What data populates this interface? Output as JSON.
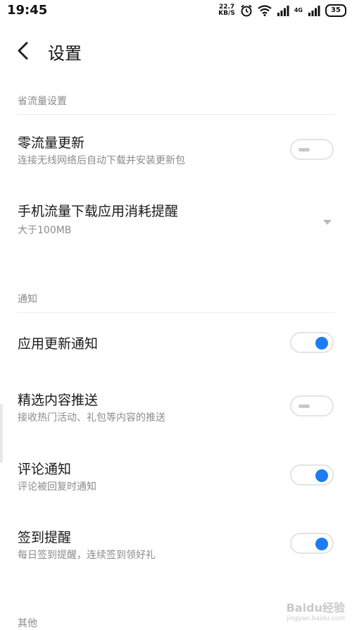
{
  "status_bar": {
    "time": "19:45",
    "net_speed_value": "22.7",
    "net_speed_unit": "KB/S",
    "network_type": "4G",
    "battery": "35"
  },
  "app_bar": {
    "title": "设置"
  },
  "sections": {
    "data_saving": {
      "header": "省流量设置",
      "zero_data_update": {
        "title": "零流量更新",
        "subtitle": "连接无线网络后自动下载并安装更新包",
        "enabled": false
      },
      "mobile_data_reminder": {
        "title": "手机流量下载应用消耗提醒",
        "value": "大于100MB"
      }
    },
    "notifications": {
      "header": "通知",
      "app_update": {
        "title": "应用更新通知",
        "enabled": true
      },
      "featured_push": {
        "title": "精选内容推送",
        "subtitle": "接收热门活动、礼包等内容的推送",
        "enabled": false
      },
      "comment": {
        "title": "评论通知",
        "subtitle": "评论被回复时通知",
        "enabled": true
      },
      "checkin": {
        "title": "签到提醒",
        "subtitle": "每日签到提醒，连续签到领好礼",
        "enabled": true
      }
    },
    "other": {
      "header": "其他"
    }
  },
  "watermark": {
    "brand": "Baidu经验",
    "url": "jingyan.baidu.com"
  },
  "colors": {
    "accent": "#1e7cf2",
    "subtitle": "#8c8c8c",
    "header": "#8a8a8a"
  }
}
